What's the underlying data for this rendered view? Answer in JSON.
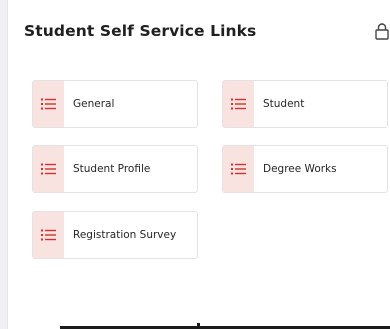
{
  "panel": {
    "title": "Student Self Service Links",
    "lock_icon": "lock-icon"
  },
  "links": [
    {
      "label": "General",
      "icon": "list-icon"
    },
    {
      "label": "Student",
      "icon": "list-icon"
    },
    {
      "label": "Student Profile",
      "icon": "list-icon"
    },
    {
      "label": "Degree Works",
      "icon": "list-icon"
    },
    {
      "label": "Registration Survey",
      "icon": "list-icon"
    }
  ],
  "colors": {
    "accent": "#d2322d",
    "icon_background": "#f9e3e1"
  }
}
